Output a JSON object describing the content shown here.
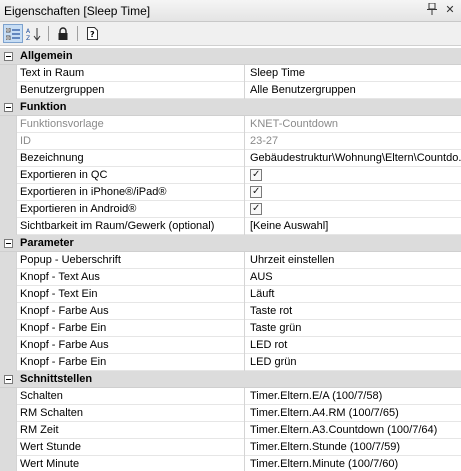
{
  "window": {
    "title": "Eigenschaften [Sleep Time]",
    "pin_icon": "pin-icon",
    "close_icon": "close-icon"
  },
  "toolbar": {
    "buttons": [
      {
        "icon": "categorized-view-icon",
        "active": true
      },
      {
        "icon": "alphabetical-sort-icon",
        "label": "A↓Z",
        "active": false
      },
      {
        "icon": "lock-icon",
        "active": false
      },
      {
        "icon": "help-page-icon",
        "label": "?",
        "active": false
      }
    ]
  },
  "categories": [
    {
      "name": "Allgemein",
      "rows": [
        {
          "name": "Text in Raum",
          "value": "Sleep Time"
        },
        {
          "name": "Benutzergruppen",
          "value": "Alle Benutzergruppen"
        }
      ]
    },
    {
      "name": "Funktion",
      "rows": [
        {
          "name": "Funktionsvorlage",
          "value": "KNET-Countdown",
          "disabled": true
        },
        {
          "name": "ID",
          "value": "23-27",
          "disabled": true
        },
        {
          "name": "Bezeichnung",
          "value": "Gebäudestruktur\\Wohnung\\Eltern\\Countdo..."
        },
        {
          "name": "Exportieren in QC",
          "checked": true
        },
        {
          "name": "Exportieren in iPhone®/iPad®",
          "checked": true
        },
        {
          "name": "Exportieren in Android®",
          "checked": true
        },
        {
          "name": "Sichtbarkeit im Raum/Gewerk (optional)",
          "value": "[Keine Auswahl]"
        }
      ]
    },
    {
      "name": "Parameter",
      "rows": [
        {
          "name": "Popup - Ueberschrift",
          "value": "Uhrzeit einstellen"
        },
        {
          "name": "Knopf - Text Aus",
          "value": "AUS"
        },
        {
          "name": "Knopf - Text Ein",
          "value": "Läuft"
        },
        {
          "name": "Knopf - Farbe Aus",
          "value": "Taste rot"
        },
        {
          "name": "Knopf - Farbe Ein",
          "value": "Taste grün"
        },
        {
          "name": "Knopf - Farbe Aus",
          "value": "LED rot"
        },
        {
          "name": "Knopf - Farbe Ein",
          "value": "LED grün"
        }
      ]
    },
    {
      "name": "Schnittstellen",
      "rows": [
        {
          "name": "Schalten",
          "value": "Timer.Eltern.E/A (100/7/58)"
        },
        {
          "name": "RM Schalten",
          "value": "Timer.Eltern.A4.RM (100/7/65)"
        },
        {
          "name": "RM Zeit",
          "value": "Timer.Eltern.A3.Countdown (100/7/64)"
        },
        {
          "name": "Wert Stunde",
          "value": "Timer.Eltern.Stunde (100/7/59)"
        },
        {
          "name": "Wert Minute",
          "value": "Timer.Eltern.Minute (100/7/60)"
        }
      ]
    }
  ],
  "colors": {
    "category_background": "#dcdcdc",
    "active_tool": "#c7ddf4",
    "disabled_text": "#8a8a8a"
  }
}
